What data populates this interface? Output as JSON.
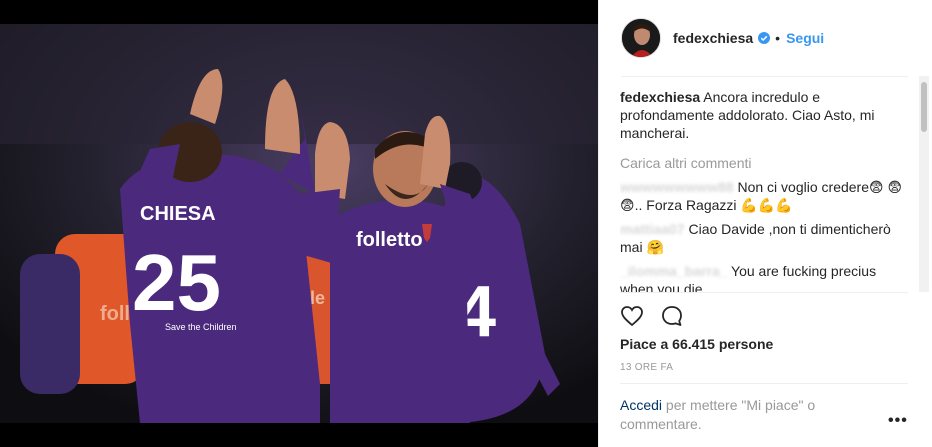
{
  "post": {
    "username": "fedexchiesa",
    "follow_label": "Segui",
    "separator_dot": "•",
    "caption_user": "fedexchiesa",
    "caption_text": "Ancora incredulo e profondamente addolorato. Ciao Asto, mi mancherai.",
    "load_more": "Carica altri commenti",
    "comments": [
      {
        "user": "wwwwwwwww88",
        "text": "Non ci voglio credere😨 😨😨.. Forza Ragazzi 💪💪💪"
      },
      {
        "user": "mattiaa07",
        "text": "Ciao Davide ,non ti dimenticherò mai 🤗"
      },
      {
        "user": "_ilomma_barra_",
        "text": "You are fucking precius when you die"
      }
    ],
    "likes_text": "Piace a 66.415 persone",
    "timestamp": "13 ORE FA",
    "login_link": "Accedi",
    "login_text": " per mettere \"Mi piace\" o commentare.",
    "more_options": "•••"
  },
  "photo": {
    "jersey_name": "CHIESA",
    "jersey_number": "25",
    "sponsor": "folletto",
    "number_right": "4",
    "save_children": "Save the Children"
  },
  "icons": {
    "verified": "verified-badge-icon",
    "like": "heart-icon",
    "comment": "comment-bubble-icon"
  },
  "colors": {
    "accent": "#3897f0",
    "link": "#003569",
    "muted": "#999999",
    "text": "#262626",
    "fiorentina_purple": "#4b2a7d"
  }
}
